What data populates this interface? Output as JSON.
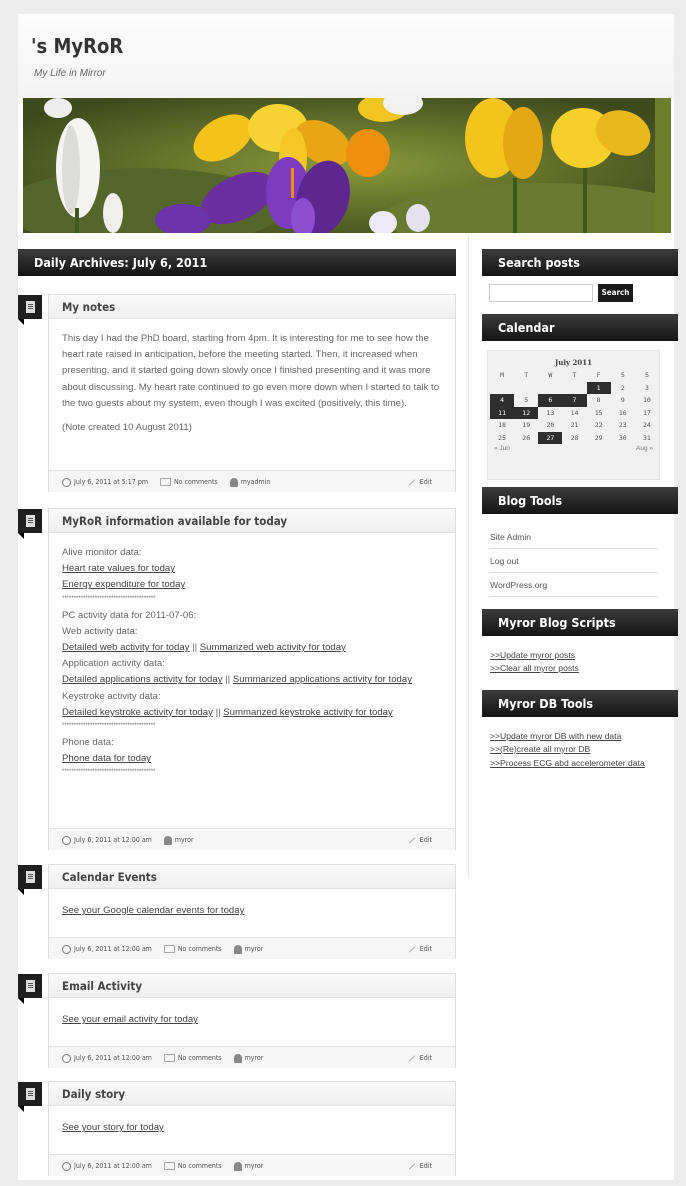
{
  "site": {
    "title": "'s MyRoR",
    "tagline": "My Life in Mirror"
  },
  "archive_heading": "Daily Archives: July 6, 2011",
  "posts": [
    {
      "title": "My notes",
      "body": [
        "This day I had the PhD board, starting from 4pm. It is interesting for me to see how the heart rate raised in anticipation, before the meeting started. Then, it increased when presenting, and it started going down slowly once I finished presenting and it was more about discussing. My heart rate continued to go even more down when I started to talk to the two guests about my system, even though I was excited (positively, this time).",
        "(Note created 10 August 2011)"
      ],
      "date": "July 6, 2011 at 5:17 pm",
      "comments": "No comments",
      "author": "myadmin",
      "edit": "Edit"
    },
    {
      "title": "MyRoR information available for today",
      "alive_label": "Alive monitor data:",
      "heart_link": "Heart rate values for today",
      "energy_link": "Energy expenditure for today",
      "stars": "****************************************",
      "pc_label": "PC activity data for 2011-07-06:",
      "web_label": "Web activity data:",
      "web_detailed": "Detailed web activity for today",
      "web_summary": "Summarized web activity for today",
      "app_label": "Application activity data:",
      "app_detailed": "Detailed applications activity for today",
      "app_summary": "Summarized applications activity for today",
      "key_label": "Keystroke activity data:",
      "key_detailed": "Detailed keystroke activity for today",
      "key_summary": "Summarized keystroke activity for today",
      "phone_label": "Phone data:",
      "phone_link": "Phone data for today",
      "sep": "||",
      "date": "July 6, 2011 at 12:00 am",
      "author": "myror",
      "edit": "Edit"
    },
    {
      "title": "Calendar Events",
      "link": "See your Google calendar events for today",
      "date": "July 6, 2011 at 12:00 am",
      "comments": "No comments",
      "author": "myror",
      "edit": "Edit"
    },
    {
      "title": "Email Activity",
      "link": "See your email activity for today",
      "date": "July 6, 2011 at 12:00 am",
      "comments": "No comments",
      "author": "myror",
      "edit": "Edit"
    },
    {
      "title": "Daily story",
      "link": "See your story for today",
      "date": "July 6, 2011 at 12:00 am",
      "comments": "No comments",
      "author": "myror",
      "edit": "Edit"
    }
  ],
  "sidebar": {
    "search_heading": "Search posts",
    "search_button": "Search",
    "search_value": "",
    "calendar_heading": "Calendar",
    "calendar": {
      "month": "July 2011",
      "weekdays": [
        "M",
        "T",
        "W",
        "T",
        "F",
        "S",
        "S"
      ],
      "weeks": [
        [
          "",
          "",
          "",
          "",
          "1",
          "2",
          "3"
        ],
        [
          "4",
          "5",
          "6",
          "7",
          "8",
          "9",
          "10"
        ],
        [
          "11",
          "12",
          "13",
          "14",
          "15",
          "16",
          "17"
        ],
        [
          "18",
          "19",
          "20",
          "21",
          "22",
          "23",
          "24"
        ],
        [
          "25",
          "26",
          "27",
          "28",
          "29",
          "30",
          "31"
        ]
      ],
      "highlighted": [
        "1",
        "4",
        "6",
        "7",
        "11",
        "12",
        "27"
      ],
      "prev": "« Jun",
      "next": "Aug »"
    },
    "blogtools_heading": "Blog Tools",
    "blogtools": [
      "Site Admin",
      "Log out",
      "WordPress.org"
    ],
    "scripts_heading": "Myror Blog Scripts",
    "scripts": [
      ">>Update myror posts",
      ">>Clear all myror posts"
    ],
    "db_heading": "Myror DB Tools",
    "db": [
      ">>Update myror DB with new data",
      ">>(Re)create all myror DB",
      ">>Process ECG abd accelerometer data"
    ]
  },
  "colors": {
    "ribbon": "#1f1f1f",
    "calendar_highlight": "#2e2e2e"
  }
}
